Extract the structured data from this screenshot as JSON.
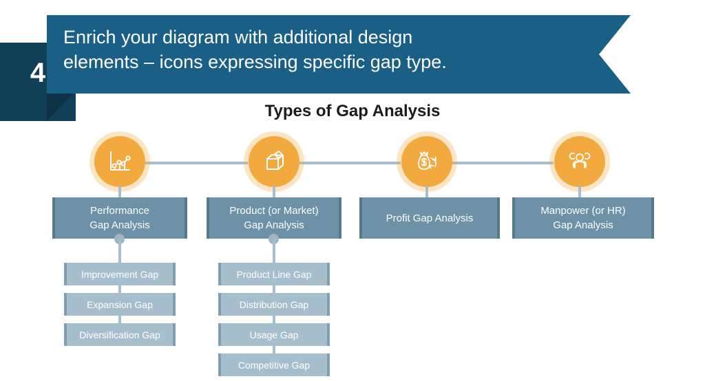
{
  "header": {
    "step_number": "4",
    "banner_lines": [
      "Enrich your diagram with additional design",
      "elements – icons expressing specific gap type."
    ]
  },
  "diagram": {
    "title": "Types of Gap Analysis",
    "colors": {
      "banner_blue": "#1a5f85",
      "badge_navy": "#123f58",
      "accent_orange": "#f2a93e",
      "box_slate": "#6d92a7",
      "sub_box_light": "#a7bfcd",
      "connector": "#a8bece"
    },
    "nodes": [
      {
        "icon": "bar-line-chart-icon",
        "label_lines": [
          "Performance",
          "Gap Analysis"
        ],
        "sub_items": [
          "Improvement Gap",
          "Expansion Gap",
          "Diversification Gap"
        ]
      },
      {
        "icon": "open-box-icon",
        "label_lines": [
          "Product (or Market)",
          "Gap Analysis"
        ],
        "sub_items": [
          "Product Line Gap",
          "Distribution Gap",
          "Usage Gap",
          "Competitive Gap"
        ]
      },
      {
        "icon": "money-bag-refresh-icon",
        "label_lines": [
          "Profit Gap Analysis"
        ],
        "sub_items": []
      },
      {
        "icon": "three-people-icon",
        "label_lines": [
          "Manpower (or HR)",
          "Gap Analysis"
        ],
        "sub_items": []
      }
    ]
  }
}
